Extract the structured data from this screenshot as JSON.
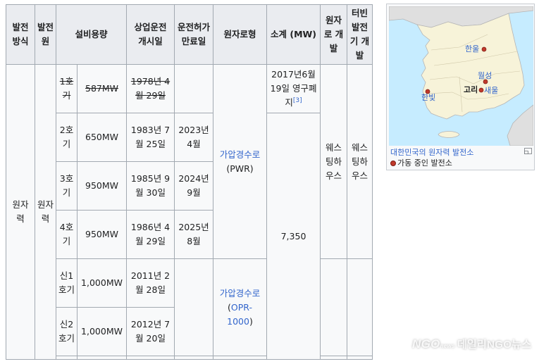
{
  "headers": [
    "발전방식",
    "발전원",
    "설비용량",
    "상업운전 개시일",
    "운전허가만료일",
    "원자로형",
    "소계 (MW)",
    "원자로 개발",
    "터빈발전기 개발"
  ],
  "rows": [
    {
      "unit": "1호기",
      "capacity": "587MW",
      "start": "1978년 4월 29일",
      "expiry": ""
    },
    {
      "unit": "2호기",
      "capacity": "650MW",
      "start": "1983년 7월 25일",
      "expiry": "2023년 4월"
    },
    {
      "unit": "3호기",
      "capacity": "950MW",
      "start": "1985년 9월 30일",
      "expiry": "2024년 9월"
    },
    {
      "unit": "4호기",
      "capacity": "950MW",
      "start": "1986년 4월 29일",
      "expiry": "2025년 8월"
    },
    {
      "unit": "신1호기",
      "capacity": "1,000MW",
      "start": "2011년 2월 28일",
      "expiry": ""
    },
    {
      "unit": "신2호기",
      "capacity": "1,000MW",
      "start": "2012년 7월 20일",
      "expiry": ""
    }
  ],
  "method": "원자력",
  "source": "원자력",
  "reactor_pwr": "가압경수로",
  "reactor_pwr_abbr": "(PWR)",
  "reactor_opr": "가압경수로",
  "reactor_opr_link": "OPR-1000",
  "reactor_opr_paren_open": "(",
  "reactor_opr_paren_close": ")",
  "unit1_status": "2017년6월 19일 영구폐지",
  "unit1_ref": "[3]",
  "subtotal": "7,350",
  "reactor_dev": "웨스팅하우스",
  "turbine_dev": "웨스팅하우스",
  "map": {
    "labels": {
      "hanul": "한울",
      "wolseong": "월성",
      "kori": "고리",
      "saeul": "새울",
      "hanbit": "한빛"
    },
    "caption_link": "대한민국의 원자력 발전소",
    "legend": "가동 중인 발전소",
    "colors": {
      "sea": "#c6ecff",
      "land": "#f7f3d9",
      "foreign": "#dfdfdf",
      "border": "#b5b5b5",
      "dot": "#c0392b"
    }
  },
  "watermark": {
    "logo": "NGO",
    "logo_sub": "news",
    "text": "데일리NGO뉴스"
  }
}
